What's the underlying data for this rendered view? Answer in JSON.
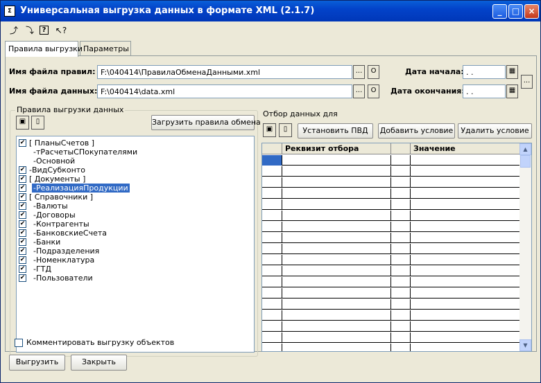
{
  "window": {
    "title": "Универсальная выгрузка данных в формате XML (2.1.7)",
    "icon_text": "Σ",
    "controls": [
      "minimize",
      "maximize",
      "close"
    ]
  },
  "toolbar": {
    "icons": [
      "open-settings-icon",
      "save-settings-icon",
      "help-icon",
      "whats-this-icon"
    ]
  },
  "tabs": [
    {
      "label": "Правила выгрузки",
      "active": true
    },
    {
      "label": "Параметры",
      "active": false
    }
  ],
  "form": {
    "rules_file_label": "Имя файла правил:",
    "rules_file_value": "F:\\040414\\ПравилаОбменаДанными.xml",
    "data_file_label": "Имя файла данных:",
    "data_file_value": "F:\\040414\\data.xml",
    "browse_label": "...",
    "open_label": "O",
    "start_date_label": "Дата начала:",
    "start_date_value": ". .",
    "end_date_label": "Дата окончания:",
    "end_date_value": ". .",
    "period_button_label": "..."
  },
  "rules_group": {
    "title": "Правила выгрузки данных",
    "load_button": "Загрузить правила обмена",
    "items": [
      {
        "label": "[ ПланыСчетов ]",
        "checked": true,
        "indent": 0,
        "show_checkbox": true,
        "selected": false
      },
      {
        "label": "-тРасчетыСПокупателями",
        "checked": false,
        "indent": 1,
        "show_checkbox": false,
        "selected": false
      },
      {
        "label": "-Основной",
        "checked": false,
        "indent": 1,
        "show_checkbox": false,
        "selected": false
      },
      {
        "label": "-ВидСубконто",
        "checked": true,
        "indent": 0,
        "show_checkbox": true,
        "selected": false
      },
      {
        "label": "[ Документы ]",
        "checked": true,
        "indent": 0,
        "show_checkbox": true,
        "selected": false
      },
      {
        "label": "-РеализацияПродукции",
        "checked": true,
        "indent": 1,
        "show_checkbox": true,
        "selected": true
      },
      {
        "label": "[ Справочники ]",
        "checked": true,
        "indent": 0,
        "show_checkbox": true,
        "selected": false
      },
      {
        "label": "-Валюты",
        "checked": true,
        "indent": 1,
        "show_checkbox": true,
        "selected": false
      },
      {
        "label": "-Договоры",
        "checked": true,
        "indent": 1,
        "show_checkbox": true,
        "selected": false
      },
      {
        "label": "-Контрагенты",
        "checked": true,
        "indent": 1,
        "show_checkbox": true,
        "selected": false
      },
      {
        "label": "-БанковскиеСчета",
        "checked": true,
        "indent": 1,
        "show_checkbox": true,
        "selected": false
      },
      {
        "label": "-Банки",
        "checked": true,
        "indent": 1,
        "show_checkbox": true,
        "selected": false
      },
      {
        "label": "-Подразделения",
        "checked": true,
        "indent": 1,
        "show_checkbox": true,
        "selected": false
      },
      {
        "label": "-Номенклатура",
        "checked": true,
        "indent": 1,
        "show_checkbox": true,
        "selected": false
      },
      {
        "label": "-ГТД",
        "checked": true,
        "indent": 1,
        "show_checkbox": true,
        "selected": false
      },
      {
        "label": "-Пользователи",
        "checked": true,
        "indent": 1,
        "show_checkbox": true,
        "selected": false
      }
    ]
  },
  "filter_group": {
    "title": "Отбор данных для",
    "set_pvd_button": "Установить ПВД",
    "add_condition_button": "Добавить условие",
    "remove_condition_button": "Удалить условие",
    "columns": [
      "",
      "Реквизит отбора",
      "",
      "Значение"
    ]
  },
  "comment_checkbox": {
    "label": "Комментировать выгрузку объектов",
    "checked": false
  },
  "bottom_buttons": {
    "export": "Выгрузить",
    "close": "Закрыть"
  },
  "colors": {
    "titlebar": "#0343c9",
    "selection": "#316ac5",
    "window_bg": "#ece9d8"
  }
}
